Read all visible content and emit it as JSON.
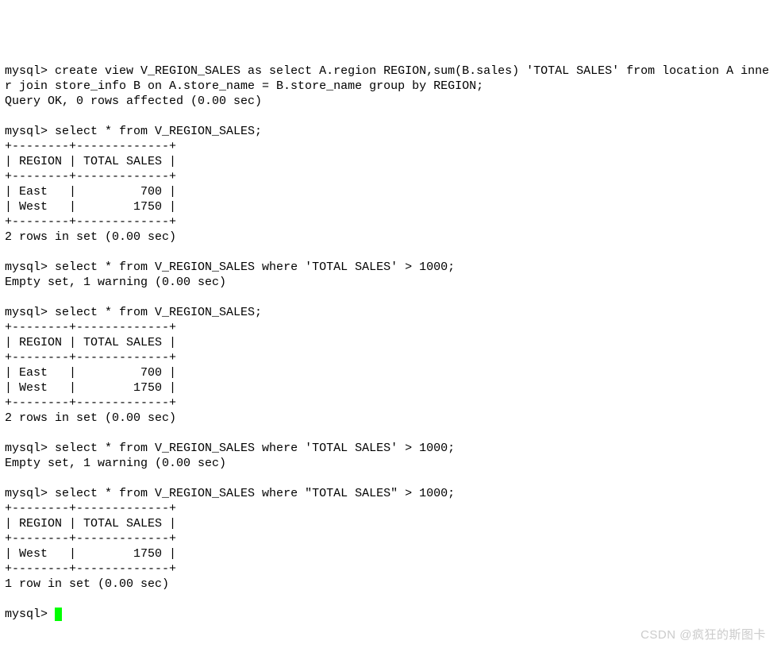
{
  "prompt": "mysql> ",
  "cmd_create_view": "create view V_REGION_SALES as select A.region REGION,sum(B.sales) 'TOTAL SALES' from location A inne\nr join store_info B on A.store_name = B.store_name group by REGION;",
  "resp_query_ok": "Query OK, 0 rows affected (0.00 sec)",
  "cmd_select_all_1": "select * from V_REGION_SALES;",
  "table_divider": "+--------+-------------+",
  "table_header": "| REGION | TOTAL SALES |",
  "row_east": "| East   |         700 |",
  "row_west": "| West   |        1750 |",
  "resp_2rows": "2 rows in set (0.00 sec)",
  "cmd_select_where_sq_1": "select * from V_REGION_SALES where 'TOTAL SALES' > 1000;",
  "resp_empty": "Empty set, 1 warning (0.00 sec)",
  "cmd_select_all_2": "select * from V_REGION_SALES;",
  "cmd_select_where_sq_2": "select * from V_REGION_SALES where 'TOTAL SALES' > 1000;",
  "cmd_select_where_dq": "select * from V_REGION_SALES where \"TOTAL SALES\" > 1000;",
  "resp_1row": "1 row in set (0.00 sec)",
  "watermark": "CSDN @疯狂的斯图卡"
}
